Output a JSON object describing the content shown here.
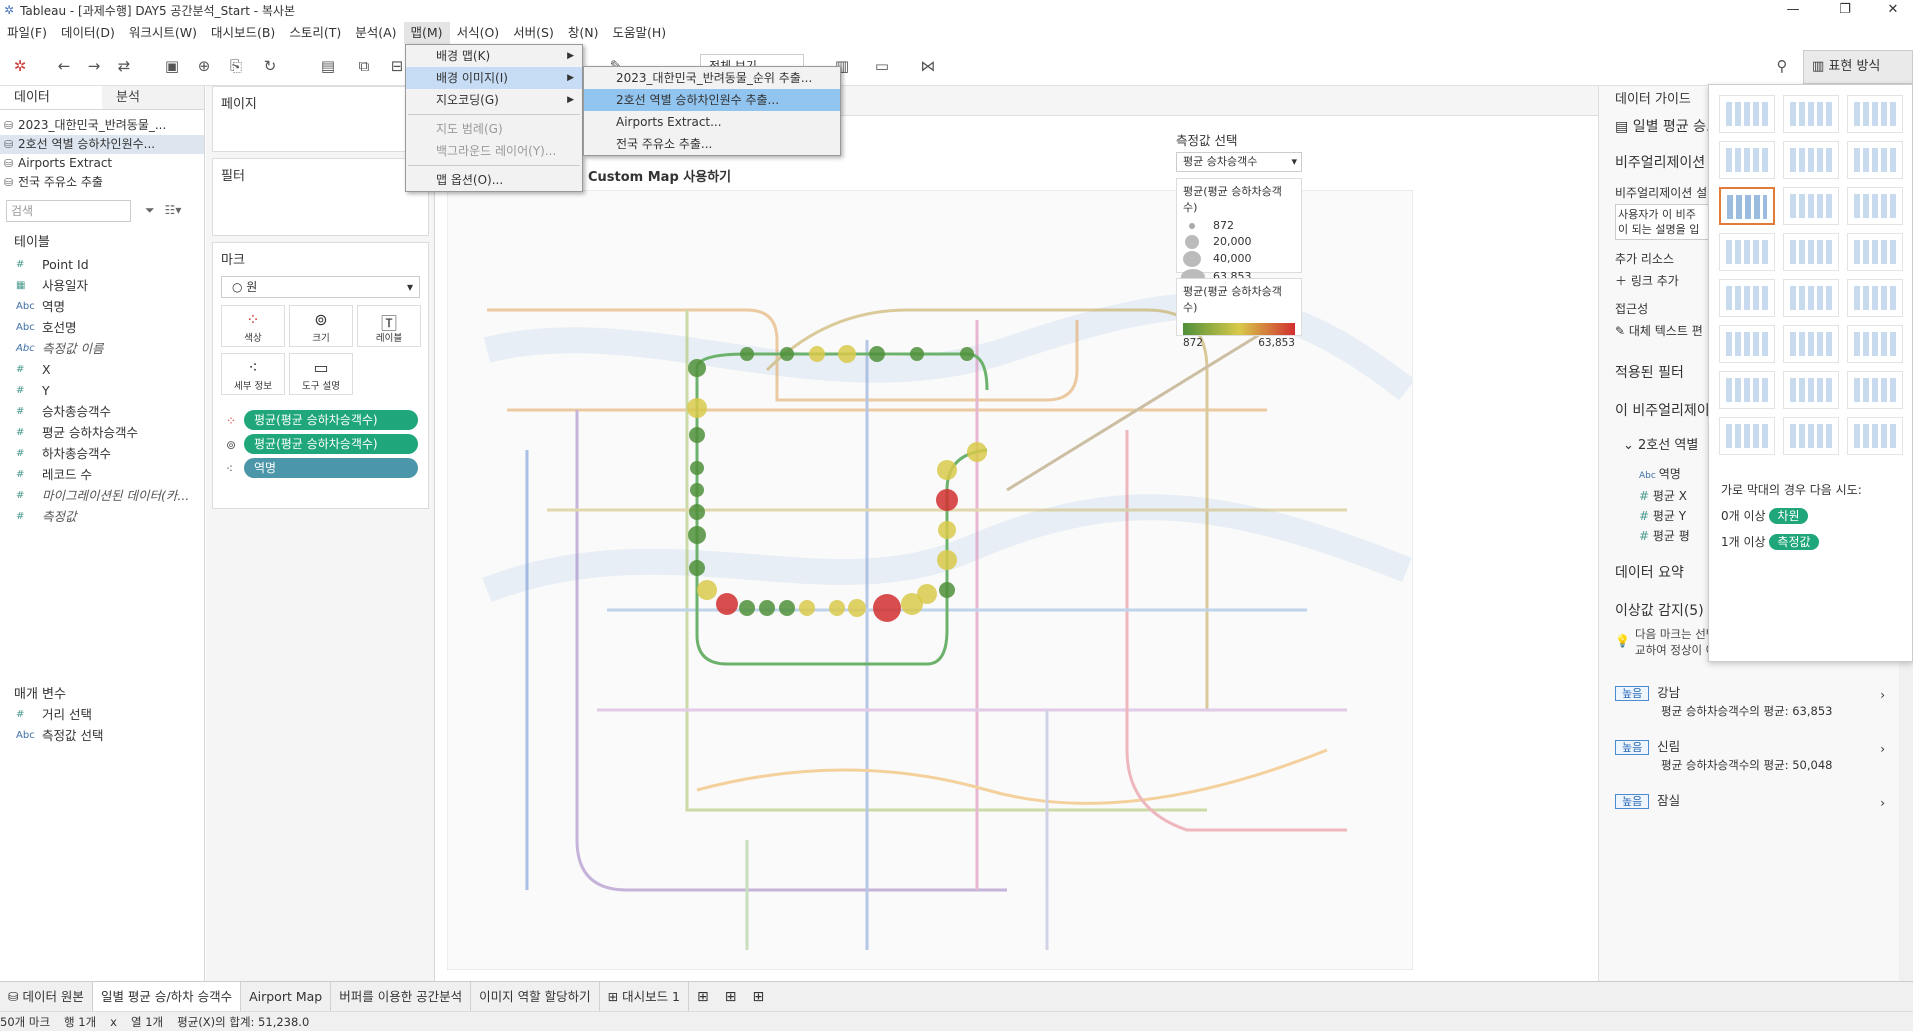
{
  "window": {
    "title": "Tableau - [과제수행] DAY5 공간분석_Start - 복사본"
  },
  "menubar": [
    "파일(F)",
    "데이터(D)",
    "워크시트(W)",
    "대시보드(B)",
    "스토리(T)",
    "분석(A)",
    "맵(M)",
    "서식(O)",
    "서버(S)",
    "창(N)",
    "도움말(H)"
  ],
  "toolbar": {
    "show_me": "표현 방식",
    "fit": "전체 보기"
  },
  "map_menu": {
    "items": [
      {
        "label": "배경 맵(K)",
        "submenu": true
      },
      {
        "label": "배경 이미지(I)",
        "submenu": true
      },
      {
        "label": "지오코딩(G)",
        "submenu": true
      },
      {
        "label": "지도 범례(G)",
        "disabled": true
      },
      {
        "label": "백그라운드 레이어(Y)...",
        "disabled": true
      },
      {
        "label": "맵 옵션(O)..."
      }
    ],
    "bg_image_submenu": [
      "2023_대한민국_반려동물_순위 추출...",
      "2호선 역별 승하차인원수 추출...",
      "Airports Extract...",
      "전국 주유소 추출..."
    ]
  },
  "data_pane": {
    "tabs": [
      "데이터",
      "분석"
    ],
    "sources": [
      "2023_대한민국_반려동물_...",
      "2호선 역별 승하차인원수...",
      "Airports Extract",
      "전국 주유소 추출"
    ],
    "search_placeholder": "검색",
    "tables_header": "테이블",
    "fields": [
      {
        "type": "#",
        "name": "Point Id"
      },
      {
        "type": "date",
        "name": "사용일자"
      },
      {
        "type": "Abc",
        "name": "역명"
      },
      {
        "type": "Abc",
        "name": "호선명"
      },
      {
        "type": "Abc",
        "name": "측정값 이름",
        "italic": true
      },
      {
        "type": "#",
        "name": "X"
      },
      {
        "type": "#",
        "name": "Y"
      },
      {
        "type": "#",
        "name": "승차총승객수"
      },
      {
        "type": "#",
        "name": "평균 승하차승객수"
      },
      {
        "type": "#",
        "name": "하차총승객수"
      },
      {
        "type": "#",
        "name": "레코드 수"
      },
      {
        "type": "#",
        "name": "마이그레이션된 데이터(카...",
        "italic": true
      },
      {
        "type": "#",
        "name": "측정값",
        "italic": true
      }
    ],
    "params_header": "매개 변수",
    "params": [
      {
        "type": "#",
        "name": "거리 선택"
      },
      {
        "type": "Abc",
        "name": "측정값 선택"
      }
    ]
  },
  "shelves": {
    "pages": "페이지",
    "filters": "필터",
    "marks": "마크",
    "mark_type": "원",
    "mark_buttons": [
      "색상",
      "크기",
      "레이블",
      "세부 정보",
      "도구 설명"
    ],
    "pills": [
      "평균(평균 승하차승객수)",
      "평균(평균 승하차승객수)",
      "역명"
    ]
  },
  "view": {
    "title": "Custom Map 사용하기",
    "measure_select": {
      "label": "측정값 선택",
      "value": "평균 승차승객수"
    },
    "size_legend": {
      "title": "평균(평균 승하차승객수)",
      "values": [
        "872",
        "20,000",
        "40,000",
        "63,853"
      ]
    },
    "color_legend": {
      "title": "평균(평균 승하차승객수)",
      "min": "872",
      "max": "63,853"
    },
    "colors": {
      "low": "#4f8f3a",
      "mid": "#d8c94a",
      "high": "#d12f2f"
    }
  },
  "guide": {
    "title": "데이터 가이드",
    "viz_label": "일별 평균 승...",
    "viz_section": "비주얼리제이션",
    "viz_desc_label": "비주얼리제이션 설",
    "viz_desc_text": "사용자가 이 비주\n이 되는 설명을 입",
    "extra_resources": "추가 리소스",
    "add_link": "링크 추가",
    "accessibility": "접근성",
    "alt_text": "대체 텍스트 편",
    "applied_filters": "적용된 필터",
    "this_viz": "이 비주얼리제이",
    "source_item": "2호선 역별",
    "source_fields": [
      "역명",
      "평균 X",
      "평균 Y",
      "평균 평"
    ],
    "data_summary": "데이터 요약",
    "outliers_title": "이상값 감지(5)",
    "outlier_desc": "다음 마크는 선택한 비주얼리제이션의 다른 마크와 비교하여 정상이 아닌 것으로 감지되었습니다.",
    "outliers": [
      {
        "badge": "높음",
        "name": "강남",
        "detail": "평균 승하차승객수의 평균: 63,853"
      },
      {
        "badge": "높음",
        "name": "신림",
        "detail": "평균 승하차승객수의 평균: 50,048"
      },
      {
        "badge": "높음",
        "name": "잠실",
        "detail": ""
      }
    ]
  },
  "showme": {
    "hint": "가로 막대의 경우 다음 시도:",
    "dim": "0개 이상",
    "dim_badge": "차원",
    "meas": "1개 이상",
    "meas_badge": "측정값"
  },
  "sheet_tabs": [
    "데이터 원본",
    "일별 평균 승/하차 승객수",
    "Airport Map",
    "버퍼를 이용한 공간분석",
    "이미지 역할 할당하기",
    "대시보드 1"
  ],
  "status": {
    "marks": "50개 마크",
    "rows": "행 1개",
    "x": "x",
    "cols": "열 1개",
    "sum": "평균(X)의 합계: 51,238.0"
  }
}
